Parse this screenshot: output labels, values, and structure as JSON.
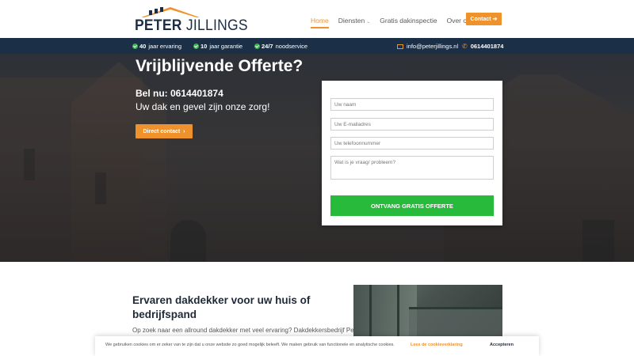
{
  "header": {
    "logo_first": "PETER",
    "logo_second": "JILLINGS",
    "nav": [
      {
        "label": "Home",
        "active": true
      },
      {
        "label": "Diensten",
        "dropdown": true
      },
      {
        "label": "Gratis dakinspectie"
      },
      {
        "label": "Over ons"
      }
    ],
    "contact_label": "Contact",
    "contact_arrow": "➔"
  },
  "infobar": {
    "usp": [
      {
        "bold": "40",
        "text": "jaar ervaring"
      },
      {
        "bold": "10",
        "text": "jaar garantie"
      },
      {
        "bold": "24/7",
        "text": "noodservice"
      }
    ],
    "email": "info@peterjillings.nl",
    "phone": "0614401874"
  },
  "hero": {
    "title": "Vrijblijvende Offerte?",
    "phone_line": "Bel nu: 0614401874",
    "subtitle": "Uw dak en gevel zijn onze zorg!",
    "button": "Direct contact",
    "button_icon": "›"
  },
  "form": {
    "name_placeholder": "Uw naam",
    "email_placeholder": "Uw E-mailadres",
    "phone_placeholder": "Uw telefoonnummer",
    "message_placeholder": "Wat is je vraag/ probleem?",
    "submit": "ONTVANG GRATIS OFFERTE"
  },
  "content": {
    "title": "Ervaren dakdekker voor uw huis of bedrijfspand",
    "text": "Op zoek naar een allround dakdekker met veel ervaring? Dakdekkersbedrijf Peter"
  },
  "cookie": {
    "text": "We gebruiken cookies om er zeker van te zijn dat u onze website zo goed mogelijk beleeft. We maken gebruik van functionele en analytische cookies.",
    "settings": "Lees de cookieverklaring",
    "accept": "Accepteren"
  },
  "colors": {
    "accent": "#f0922b",
    "navy": "#1b2f47",
    "green": "#27ba3b"
  }
}
